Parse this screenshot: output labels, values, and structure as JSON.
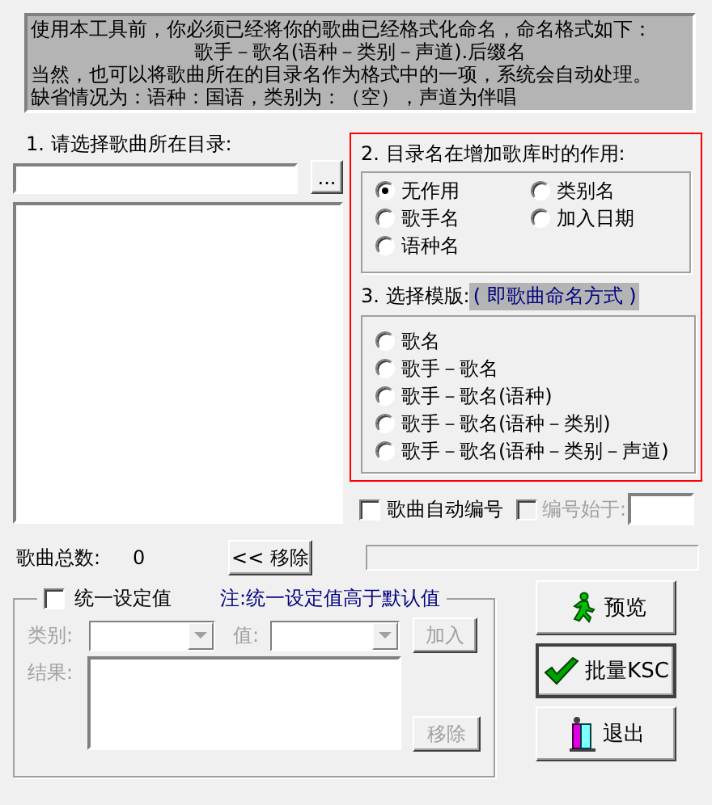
{
  "info_box": {
    "lines": [
      "使用本工具前，你必须已经将你的歌曲已经格式化命名，命名格式如下：",
      "歌手－歌名(语种－类别－声道).后缀名",
      "当然，也可以将歌曲所在的目录名作为格式中的一项，系统会自动处理。",
      "缺省情况为：语种：国语，类别为：（空），声道为伴唱"
    ]
  },
  "directory": {
    "label": "1. 请选择歌曲所在目录:",
    "browse_button": "..."
  },
  "directory_role": {
    "title": "2. 目录名在增加歌库时的作用:",
    "options": [
      {
        "label": "无作用",
        "selected": true
      },
      {
        "label": "类别名",
        "selected": false
      },
      {
        "label": "歌手名",
        "selected": false
      },
      {
        "label": "加入日期",
        "selected": false
      },
      {
        "label": "语种名",
        "selected": false
      }
    ]
  },
  "template": {
    "title": "3. 选择模版:",
    "hint": "( 即歌曲命名方式 )",
    "options": [
      {
        "label": "歌名",
        "selected": false
      },
      {
        "label": "歌手－歌名",
        "selected": false
      },
      {
        "label": "歌手－歌名(语种)",
        "selected": false
      },
      {
        "label": "歌手－歌名(语种－类别)",
        "selected": false
      },
      {
        "label": "歌手－歌名(语种－类别－声道)",
        "selected": false
      }
    ]
  },
  "auto_number": {
    "label": "歌曲自动编号",
    "checked": false
  },
  "start_number": {
    "label": "编号始于:",
    "checked": false,
    "disabled": true
  },
  "song_total": {
    "label": "歌曲总数:",
    "value": "0"
  },
  "remove_button": "<< 移除",
  "progress": {
    "level": 0
  },
  "unified": {
    "label": "统一设定值",
    "checked": false,
    "disabled": true,
    "note": "注:统一设定值高于默认值",
    "category_label": "类别:",
    "value_label": "值:",
    "add_button": "加入",
    "result_label": "结果:",
    "remove_button": "移除"
  },
  "actions": [
    {
      "kind": "preview",
      "label": "预览",
      "default": false
    },
    {
      "kind": "batch",
      "label": "批量KSC",
      "default": true
    },
    {
      "kind": "exit",
      "label": "退出",
      "default": false
    }
  ]
}
